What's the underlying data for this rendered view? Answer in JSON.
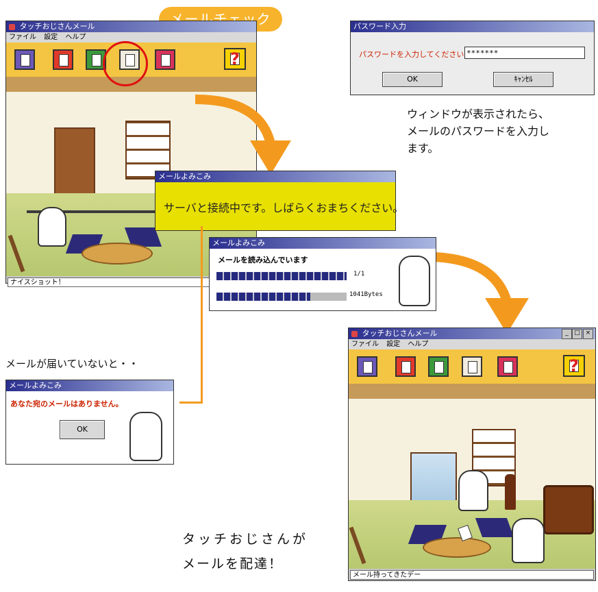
{
  "callout": {
    "label": "メールチェック",
    "color": "#f7b32b"
  },
  "main_window": {
    "title": "タッチおじさんメール",
    "menu": [
      "ファイル",
      "設定",
      "ヘルプ"
    ],
    "help_glyph": "?",
    "status": "ナイスショット！"
  },
  "password_dialog": {
    "title": "パスワード入力",
    "prompt": "パスワードを入力してください",
    "value": "*******",
    "ok": "OK",
    "cancel": "ｷｬﾝｾﾙ"
  },
  "password_caption": [
    "ウィンドウが表示されたら、",
    "メールのパスワードを入力し",
    "ます。"
  ],
  "connect_dialog": {
    "title": "メールよみこみ",
    "message": "サーバと接続中です。しばらくおまちください。",
    "bg": "#e8e000"
  },
  "progress_dialog": {
    "title": "メールよみこみ",
    "heading": "メールを読み込んでいます",
    "count_label": "1/1",
    "count_progress": 1.0,
    "bytes_label": "1041Bytes",
    "bytes_progress": 0.72
  },
  "no_mail_caption": "メールが届いていないと・・",
  "no_mail_dialog": {
    "title": "メールよみこみ",
    "message": "あなた宛のメールはありません。",
    "ok": "OK"
  },
  "result_window": {
    "title": "タッチおじさんメール",
    "menu": [
      "ファイル",
      "設定",
      "ヘルプ"
    ],
    "help_glyph": "?",
    "controls": [
      "_",
      "□",
      "×"
    ],
    "status": "メール持ってきたデー"
  },
  "delivery_caption": [
    "タッチおじさんが",
    "メールを配達！"
  ],
  "icons": [
    "mail-compose-icon",
    "mailbox-icon",
    "inbox-icon",
    "mail-check-icon",
    "address-book-icon",
    "help-icon",
    "arrow-icon",
    "highlight-circle-icon",
    "character-icon"
  ],
  "colors": {
    "arrow": "#f39a1e",
    "toolbar": "#f4c542",
    "title_gradient_start": "#2b2f8f",
    "red_text": "#cc2200"
  }
}
